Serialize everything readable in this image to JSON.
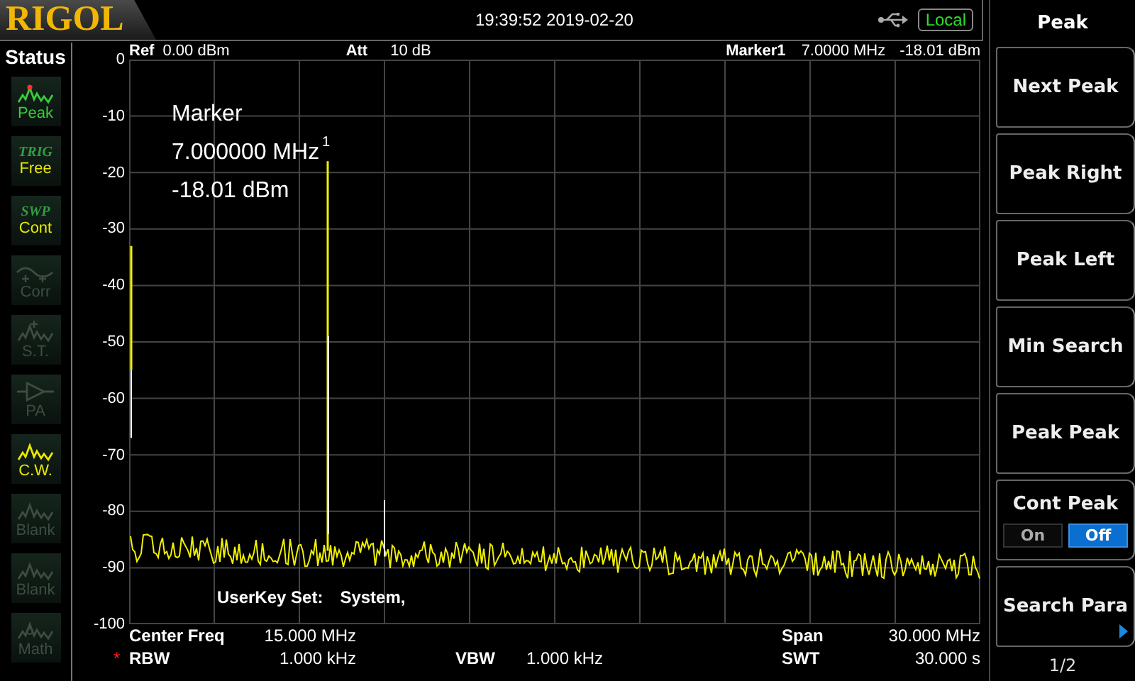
{
  "header": {
    "logo": "RIGOL",
    "datetime": "19:39:52 2019-02-20",
    "remote": "Local"
  },
  "status": {
    "title": "Status",
    "items": [
      {
        "kind": "peak",
        "label": "Peak",
        "color": "#3ccc3c"
      },
      {
        "kind": "text",
        "header": "TRIG",
        "label": "Free",
        "color": "#e8e800"
      },
      {
        "kind": "text",
        "header": "SWP",
        "label": "Cont",
        "color": "#e8e800"
      },
      {
        "kind": "corr",
        "label": "Corr",
        "color": "#3d4d40"
      },
      {
        "kind": "st",
        "label": "S.T.",
        "color": "#3d4d40"
      },
      {
        "kind": "pa",
        "label": "PA",
        "color": "#3d4d40"
      },
      {
        "kind": "wave",
        "label": "C.W.",
        "color": "#e8e800"
      },
      {
        "kind": "wave",
        "label": "Blank",
        "color": "#3d4d40"
      },
      {
        "kind": "wave",
        "label": "Blank",
        "color": "#3d4d40"
      },
      {
        "kind": "math",
        "label": "Math",
        "color": "#3d4d40"
      }
    ]
  },
  "spectrum": {
    "ref_label": "Ref",
    "ref": "0.00 dBm",
    "att_label": "Att",
    "att": "10 dB",
    "marker_label": "Marker1",
    "marker_freq": "7.0000 MHz",
    "marker_amp": "-18.01 dBm",
    "y_labels": [
      "0",
      "-10",
      "-20",
      "-30",
      "-40",
      "-50",
      "-60",
      "-70",
      "-80",
      "-90",
      "-100"
    ],
    "marker_readout": [
      "Marker",
      "7.000000 MHz",
      "-18.01 dBm"
    ],
    "marker_number": "1",
    "userkey_label": "UserKey Set:",
    "userkey_value": "System,"
  },
  "footer": {
    "center_freq": {
      "label": "Center Freq",
      "value": "15.000 MHz"
    },
    "span": {
      "label": "Span",
      "value": "30.000 MHz"
    },
    "rbw": {
      "mark": "*",
      "label": "RBW",
      "value": "1.000 kHz"
    },
    "vbw": {
      "label": "VBW",
      "value": "1.000 kHz"
    },
    "swt": {
      "label": "SWT",
      "value": "30.000 s"
    }
  },
  "softkeys": {
    "title": "Peak",
    "keys": [
      {
        "kind": "action",
        "label": "Next Peak"
      },
      {
        "kind": "action",
        "label": "Peak Right"
      },
      {
        "kind": "action",
        "label": "Peak Left"
      },
      {
        "kind": "action",
        "label": "Min Search"
      },
      {
        "kind": "action",
        "label": "Peak Peak"
      },
      {
        "kind": "toggle",
        "label": "Cont Peak",
        "options": [
          {
            "label": "On",
            "selected": false
          },
          {
            "label": "Off",
            "selected": true
          }
        ]
      },
      {
        "kind": "submenu",
        "label": "Search Para"
      }
    ],
    "page": "1/2"
  }
}
